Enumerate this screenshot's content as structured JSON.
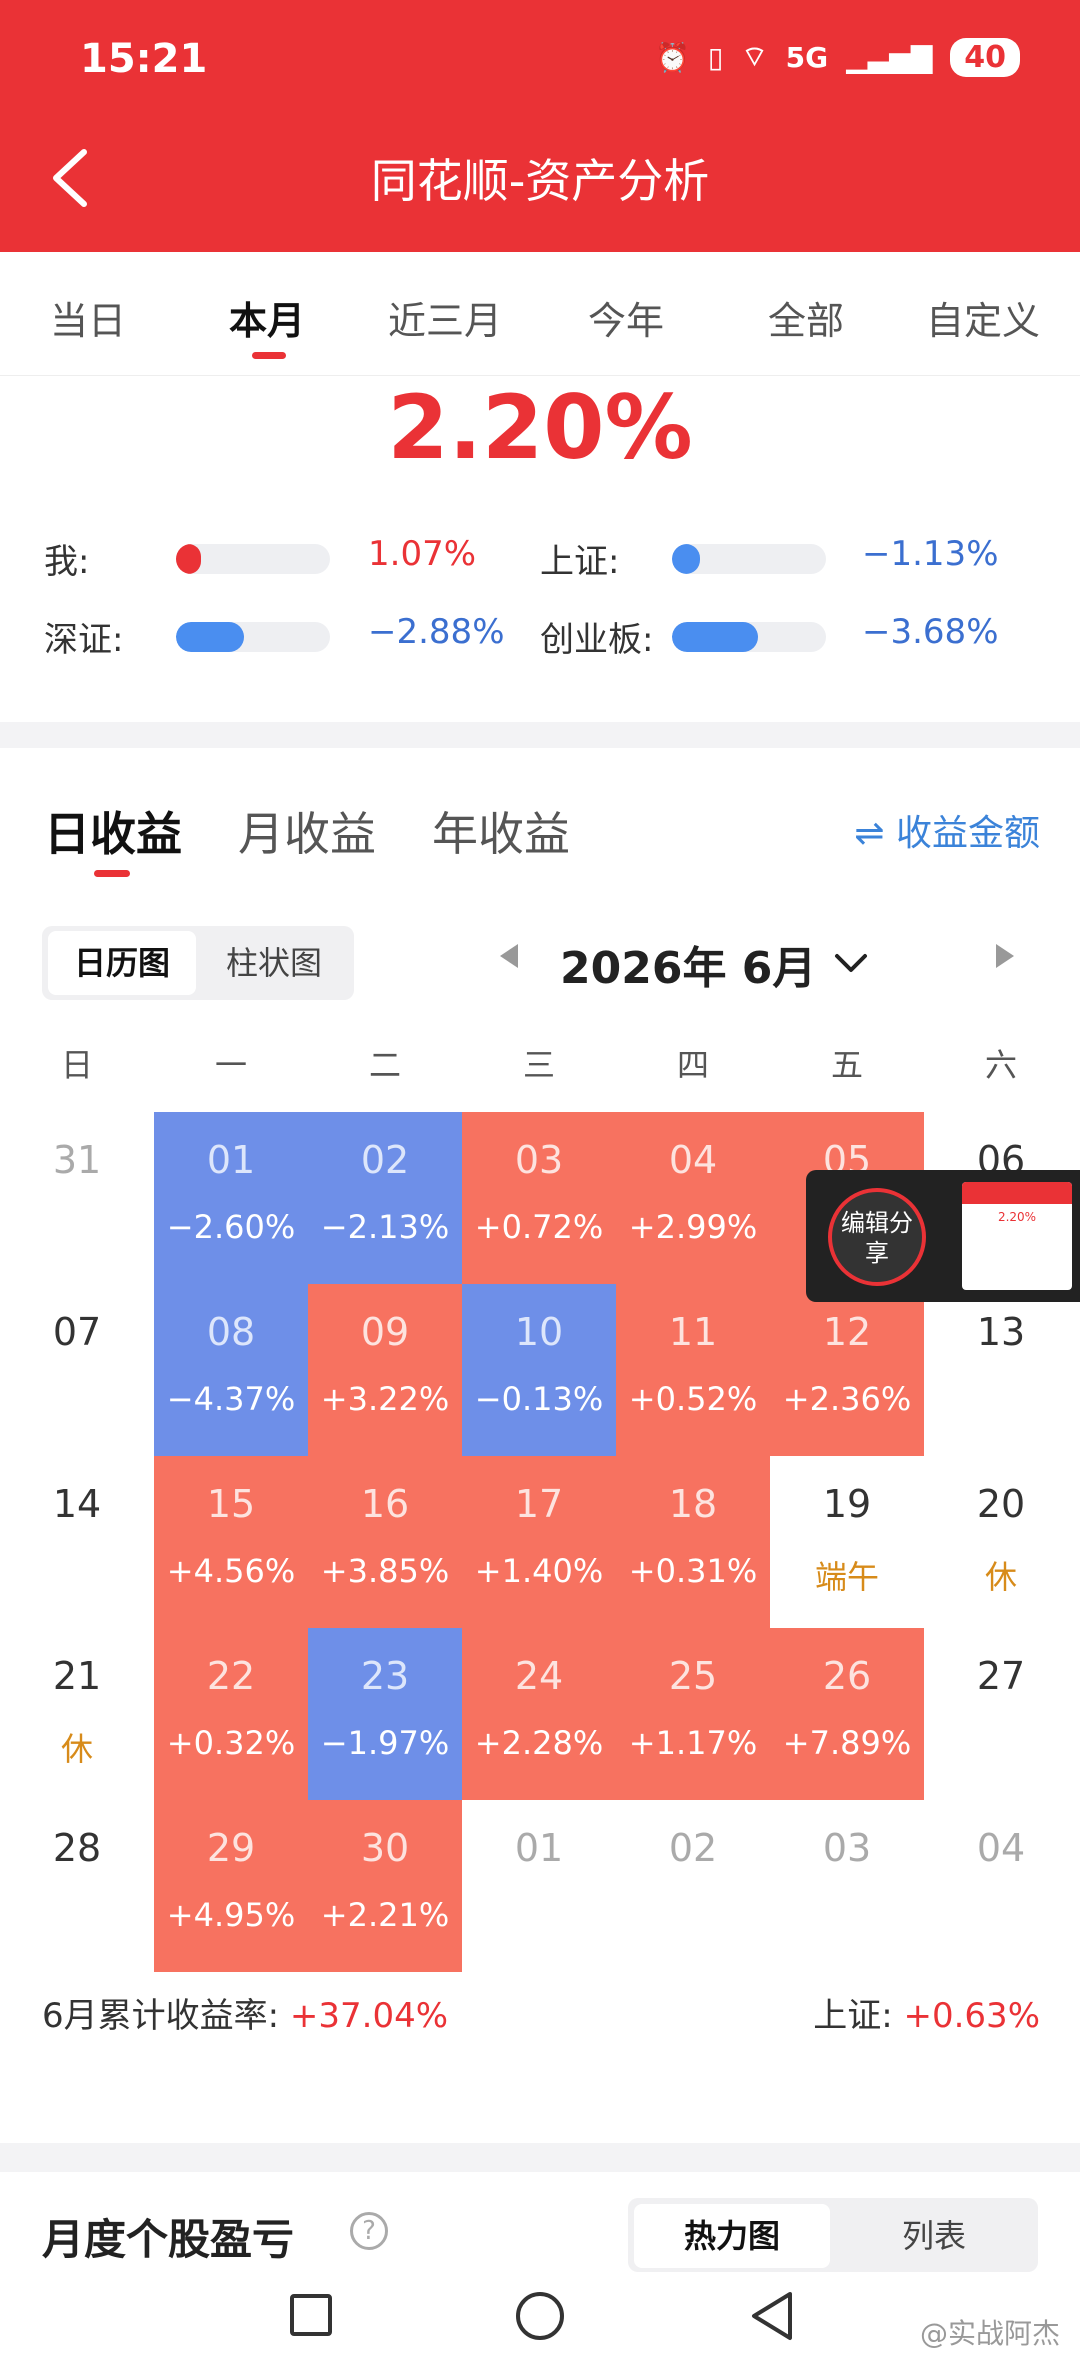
{
  "status_bar": {
    "time": "15:21",
    "network": "5G",
    "battery": "40"
  },
  "header": {
    "title": "同花顺-资产分析"
  },
  "period_tabs": [
    {
      "label": "当日",
      "active": false
    },
    {
      "label": "本月",
      "active": true
    },
    {
      "label": "近三月",
      "active": false
    },
    {
      "label": "今年",
      "active": false
    },
    {
      "label": "全部",
      "active": false
    },
    {
      "label": "自定义",
      "active": false
    }
  ],
  "summary": {
    "rate": "2.20%",
    "comparisons": [
      {
        "label": "我:",
        "value": "1.07%",
        "bar_fraction": 0.16,
        "color": "#ea3236"
      },
      {
        "label": "上证:",
        "value": "−1.13%",
        "bar_fraction": 0.18,
        "color": "#4a8ef0"
      },
      {
        "label": "深证:",
        "value": "−2.88%",
        "bar_fraction": 0.44,
        "color": "#4a8ef0"
      },
      {
        "label": "创业板:",
        "value": "−3.68%",
        "bar_fraction": 0.56,
        "color": "#4a8ef0"
      }
    ]
  },
  "return_tabs": [
    {
      "label": "日收益",
      "active": true
    },
    {
      "label": "月收益",
      "active": false
    },
    {
      "label": "年收益",
      "active": false
    }
  ],
  "amount_toggle": "⇌ 收益金额",
  "view_toggle": {
    "calendar": "日历图",
    "bar": "柱状图"
  },
  "month": {
    "label": "2026年 6月"
  },
  "weekdays": [
    "日",
    "一",
    "二",
    "三",
    "四",
    "五",
    "六"
  ],
  "calendar_rows": [
    [
      {
        "day": "31",
        "type": "other"
      },
      {
        "day": "01",
        "type": "neg",
        "pct": "−2.60%"
      },
      {
        "day": "02",
        "type": "neg",
        "pct": "−2.13%"
      },
      {
        "day": "03",
        "type": "pos",
        "pct": "+0.72%"
      },
      {
        "day": "04",
        "type": "pos",
        "pct": "+2.99%"
      },
      {
        "day": "05",
        "type": "pos",
        "pct": "+5"
      },
      {
        "day": "06",
        "type": "plain"
      }
    ],
    [
      {
        "day": "07",
        "type": "plain"
      },
      {
        "day": "08",
        "type": "neg",
        "pct": "−4.37%"
      },
      {
        "day": "09",
        "type": "pos",
        "pct": "+3.22%"
      },
      {
        "day": "10",
        "type": "neg",
        "pct": "−0.13%"
      },
      {
        "day": "11",
        "type": "pos",
        "pct": "+0.52%"
      },
      {
        "day": "12",
        "type": "pos",
        "pct": "+2.36%"
      },
      {
        "day": "13",
        "type": "plain"
      }
    ],
    [
      {
        "day": "14",
        "type": "plain"
      },
      {
        "day": "15",
        "type": "pos",
        "pct": "+4.56%"
      },
      {
        "day": "16",
        "type": "pos",
        "pct": "+3.85%"
      },
      {
        "day": "17",
        "type": "pos",
        "pct": "+1.40%"
      },
      {
        "day": "18",
        "type": "pos",
        "pct": "+0.31%"
      },
      {
        "day": "19",
        "type": "plain",
        "holiday": "端午"
      },
      {
        "day": "20",
        "type": "plain",
        "holiday": "休"
      }
    ],
    [
      {
        "day": "21",
        "type": "plain",
        "holiday": "休"
      },
      {
        "day": "22",
        "type": "pos",
        "pct": "+0.32%"
      },
      {
        "day": "23",
        "type": "neg",
        "pct": "−1.97%"
      },
      {
        "day": "24",
        "type": "pos",
        "pct": "+2.28%"
      },
      {
        "day": "25",
        "type": "pos",
        "pct": "+1.17%"
      },
      {
        "day": "26",
        "type": "pos",
        "pct": "+7.89%"
      },
      {
        "day": "27",
        "type": "plain"
      }
    ],
    [
      {
        "day": "28",
        "type": "plain"
      },
      {
        "day": "29",
        "type": "pos",
        "pct": "+4.95%"
      },
      {
        "day": "30",
        "type": "pos",
        "pct": "+2.21%"
      },
      {
        "day": "01",
        "type": "other"
      },
      {
        "day": "02",
        "type": "other"
      },
      {
        "day": "03",
        "type": "other"
      },
      {
        "day": "04",
        "type": "other"
      }
    ]
  ],
  "footer": {
    "cumulative_label": "6月累计收益率:",
    "cumulative_value": "+37.04%",
    "index_label": "上证:",
    "index_value": "+0.63%"
  },
  "bottom_section": {
    "title": "月度个股盈亏",
    "help_icon": "?",
    "view_heatmap": "热力图",
    "view_list": "列表"
  },
  "floating_overlay": {
    "edit_share": "编辑分享",
    "thumb_value": "2.20%"
  },
  "watermark": "@实战阿杰"
}
